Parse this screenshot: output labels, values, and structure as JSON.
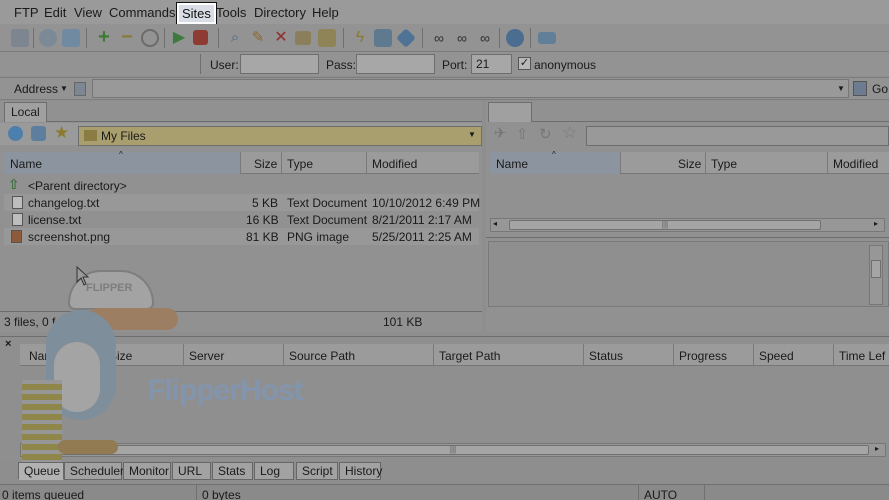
{
  "menubar": {
    "items": [
      "FTP",
      "Edit",
      "View",
      "Commands",
      "Sites",
      "Tools",
      "Directory",
      "Help"
    ],
    "active": "Sites"
  },
  "toolbar": {
    "icons": [
      "site-manager-icon",
      "settings-icon",
      "window-icon",
      "add-icon",
      "remove-icon",
      "refresh-icon",
      "play-icon",
      "stop-icon",
      "search-icon",
      "edit-icon",
      "delete-icon",
      "rename-icon",
      "folder-icon",
      "connect-icon",
      "image-icon",
      "bookmark-icon",
      "binoculars-icon",
      "binoculars-icon",
      "binoculars-icon",
      "globe-icon",
      "book-icon"
    ]
  },
  "connection": {
    "user_label": "User:",
    "pass_label": "Pass:",
    "port_label": "Port:",
    "port_value": "21",
    "anonymous_label": "anonymous",
    "anonymous_checked": "✓"
  },
  "address": {
    "label": "Address",
    "go_label": "Go"
  },
  "local": {
    "tab_label": "Local",
    "path": "My Files",
    "columns": [
      "Name",
      "Size",
      "Type",
      "Modified"
    ],
    "parent": "<Parent directory>",
    "files": [
      {
        "name": "changelog.txt",
        "size": "5 KB",
        "type": "Text Document",
        "modified": "10/10/2012 6:49 PM"
      },
      {
        "name": "license.txt",
        "size": "16 KB",
        "type": "Text Document",
        "modified": "8/21/2011 2:17 AM"
      },
      {
        "name": "screenshot.png",
        "size": "81 KB",
        "type": "PNG image",
        "modified": "5/25/2011 2:25 AM"
      }
    ],
    "status_count": "3 files, 0 folders",
    "status_filter": "(∨)",
    "status_size": "101 KB"
  },
  "remote": {
    "columns": [
      "Name",
      "Size",
      "Type",
      "Modified"
    ]
  },
  "queue": {
    "columns": [
      "Name",
      "Size",
      "Server",
      "Source Path",
      "Target Path",
      "Status",
      "Progress",
      "Speed",
      "Time Lef"
    ]
  },
  "bottom_tabs": [
    "Queue",
    "Scheduler",
    "Monitor",
    "URL",
    "Stats",
    "Log",
    "Script",
    "History"
  ],
  "status": {
    "items_queued": "0 items queued",
    "bytes": "0 bytes",
    "mode": "AUTO"
  },
  "watermark": {
    "brand": "FlipperHost",
    "cap_text": "FLIPPER"
  },
  "colors": {
    "dim_overlay": "#8e8e8e",
    "highlight_border": "#ffffff",
    "path_highlight": "#a99f6e"
  }
}
